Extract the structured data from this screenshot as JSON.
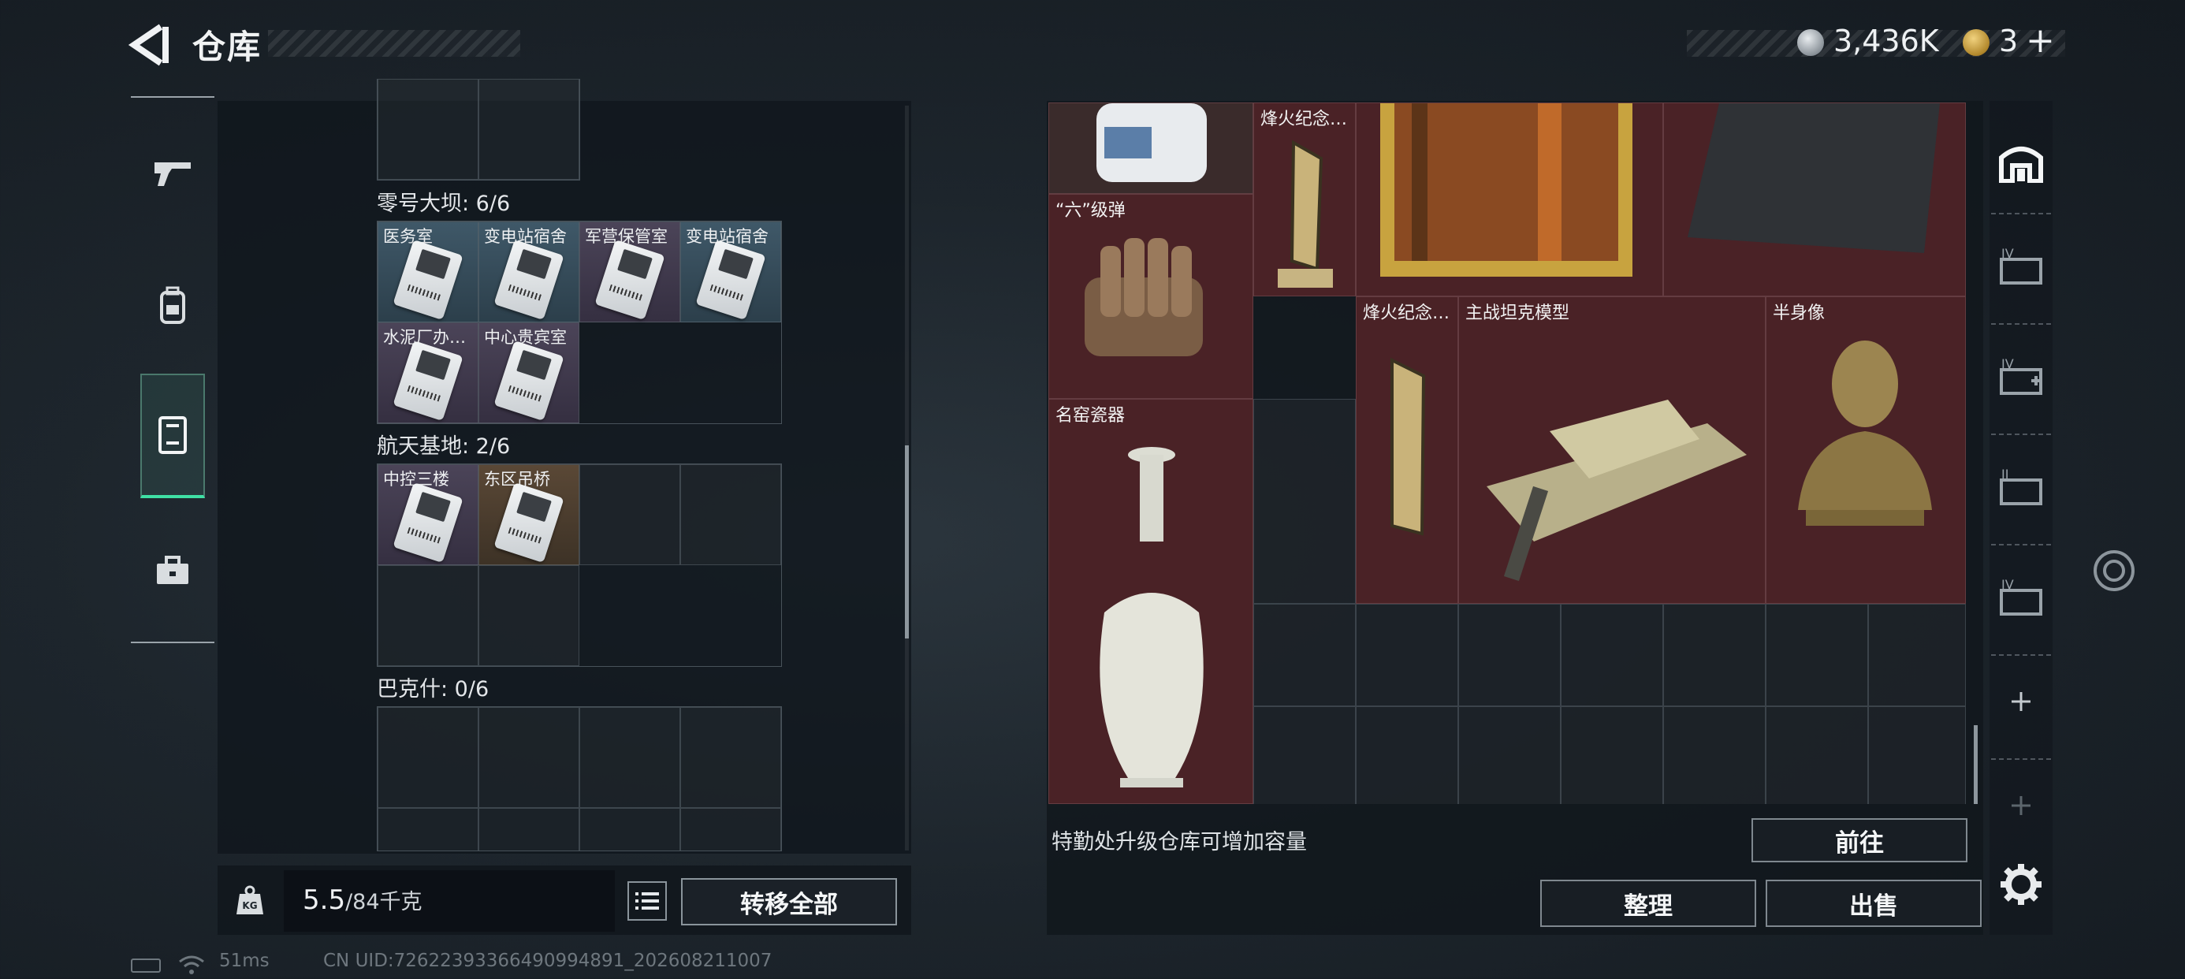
{
  "header": {
    "title": "仓库"
  },
  "currency": {
    "coins": "3,436K",
    "tickets": "3",
    "plus": "+"
  },
  "left_nav": [
    {
      "name": "weapons",
      "icon": "pistol-icon"
    },
    {
      "name": "equipment",
      "icon": "backpack-icon"
    },
    {
      "name": "storage",
      "icon": "locker-icon",
      "active": true
    },
    {
      "name": "supplies",
      "icon": "toolbox-icon"
    }
  ],
  "keycards": {
    "sections": [
      {
        "label": "零号大坝: 6/6",
        "items": [
          "医务室",
          "变电站宿舍",
          "军营保管室",
          "变电站宿舍",
          "水泥厂办…",
          "中心贵宾室"
        ]
      },
      {
        "label": "航天基地: 2/6",
        "items": [
          "中控三楼",
          "东区吊桥"
        ]
      },
      {
        "label": "巴克什: 0/6",
        "items": []
      }
    ]
  },
  "capacity": {
    "current": "5.5",
    "max": "/84千克",
    "transfer_all": "转移全部"
  },
  "stash": {
    "items": [
      {
        "name": "烽火纪念…",
        "icon": "monument-trophy-icon"
      },
      {
        "name": "“六”级弹",
        "icon": "ammo-icon"
      },
      {
        "name": "烽火纪念…",
        "icon": "monument-trophy-icon"
      },
      {
        "name": "主战坦克模型",
        "icon": "tank-model-icon"
      },
      {
        "name": "半身像",
        "icon": "bust-icon"
      },
      {
        "name": "名窑瓷器",
        "icon": "porcelain-vase-icon"
      }
    ],
    "hint": "特勤处升级仓库可增加容量",
    "goto": "前往",
    "sort": "整理",
    "sell": "出售"
  },
  "status": {
    "ping": "51ms",
    "uid": "CN UID:7262239336649099489​1_202608211007"
  }
}
